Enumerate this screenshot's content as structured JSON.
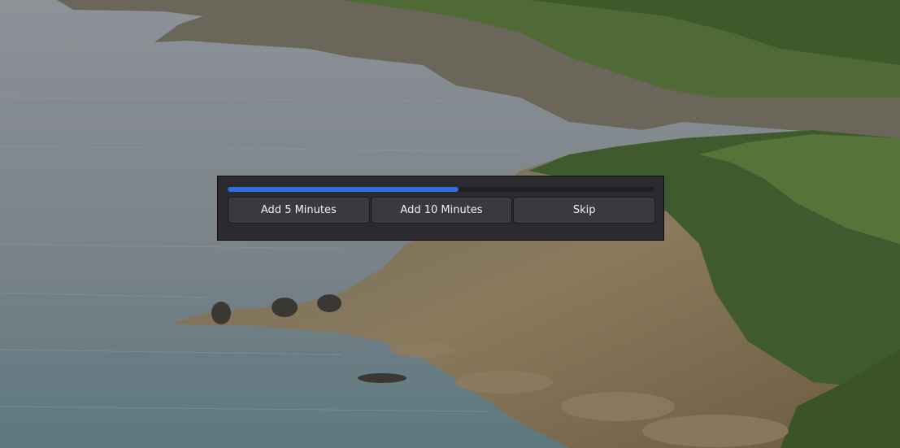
{
  "wallpaper": {
    "description_icon": "coastal-landscape-image"
  },
  "break_dialog": {
    "progress": 0.54,
    "progress_color": "#2f6fe0",
    "buttons": [
      {
        "label": "Add 5 Minutes"
      },
      {
        "label": "Add 10 Minutes"
      },
      {
        "label": "Skip"
      }
    ]
  }
}
